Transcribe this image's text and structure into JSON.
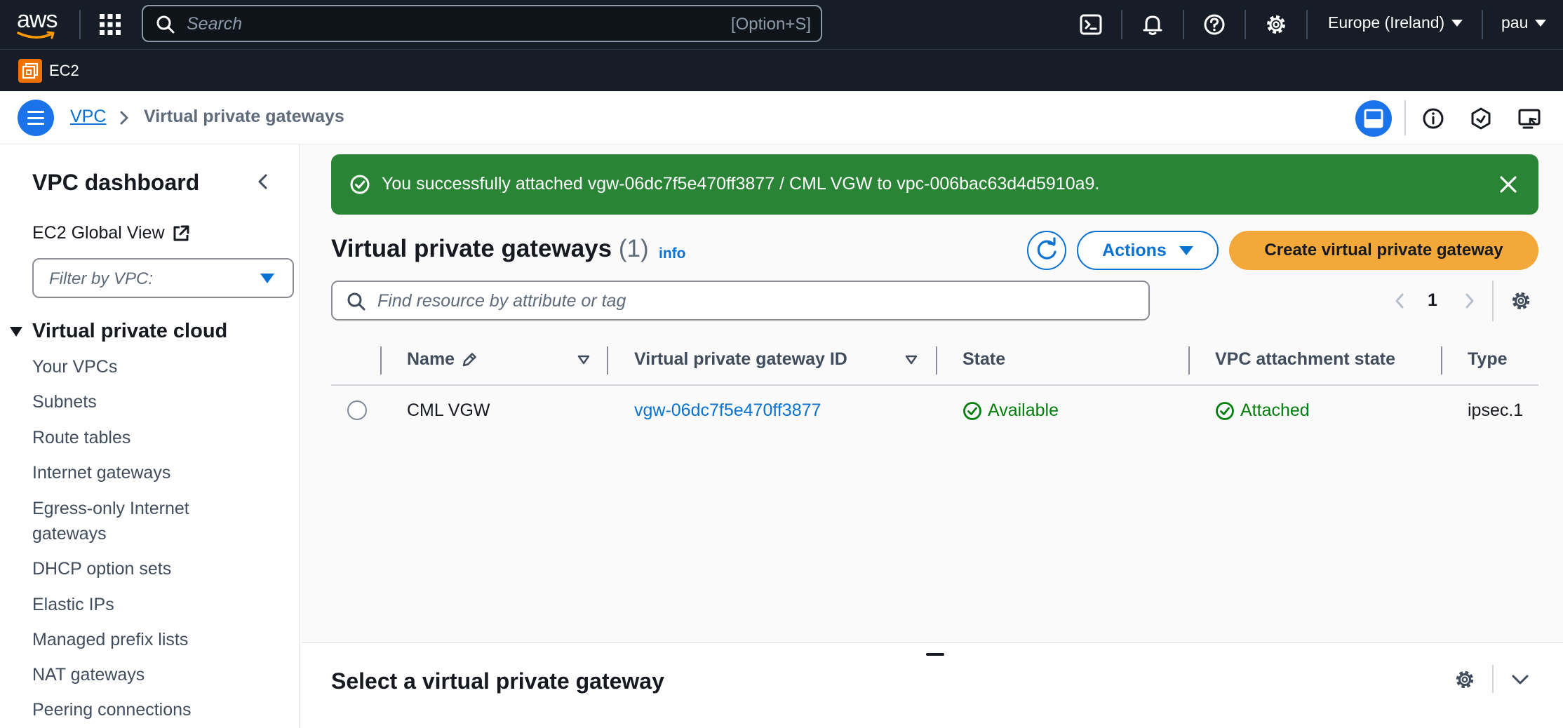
{
  "topnav": {
    "logo": "aws",
    "search": {
      "placeholder": "Search",
      "shortcut": "[Option+S]"
    },
    "region": "Europe (Ireland)",
    "user": "pau",
    "icons": [
      "cloudshell-icon",
      "bell-icon",
      "help-icon",
      "gear-icon"
    ]
  },
  "servicebar": {
    "service": "EC2"
  },
  "breadcrumb": {
    "root": "VPC",
    "current": "Virtual private gateways"
  },
  "sidebar": {
    "title": "VPC dashboard",
    "global_view": "EC2 Global View",
    "filter_placeholder": "Filter by VPC:",
    "section": "Virtual private cloud",
    "items": [
      "Your VPCs",
      "Subnets",
      "Route tables",
      "Internet gateways",
      "Egress-only Internet gateways",
      "DHCP option sets",
      "Elastic IPs",
      "Managed prefix lists",
      "NAT gateways",
      "Peering connections"
    ]
  },
  "flash": {
    "message": "You successfully attached vgw-06dc7f5e470ff3877 / CML VGW to vpc-006bac63d4d5910a9."
  },
  "panel": {
    "title": "Virtual private gateways",
    "count": "(1)",
    "info": "info",
    "actions_label": "Actions",
    "create_label": "Create virtual private gateway",
    "filter_placeholder": "Find resource by attribute or tag",
    "page": "1"
  },
  "table": {
    "columns": [
      "Name",
      "Virtual private gateway ID",
      "State",
      "VPC attachment state",
      "Type"
    ],
    "rows": [
      {
        "name": "CML VGW",
        "id": "vgw-06dc7f5e470ff3877",
        "state": "Available",
        "attachment": "Attached",
        "type": "ipsec.1"
      }
    ]
  },
  "split_panel": {
    "title": "Select a virtual private gateway"
  },
  "colors": {
    "nav_bg": "#161d26",
    "link": "#0972d3",
    "success_flash": "#2a8436",
    "status_green": "#037f0c",
    "primary_button": "#f3a83a"
  }
}
